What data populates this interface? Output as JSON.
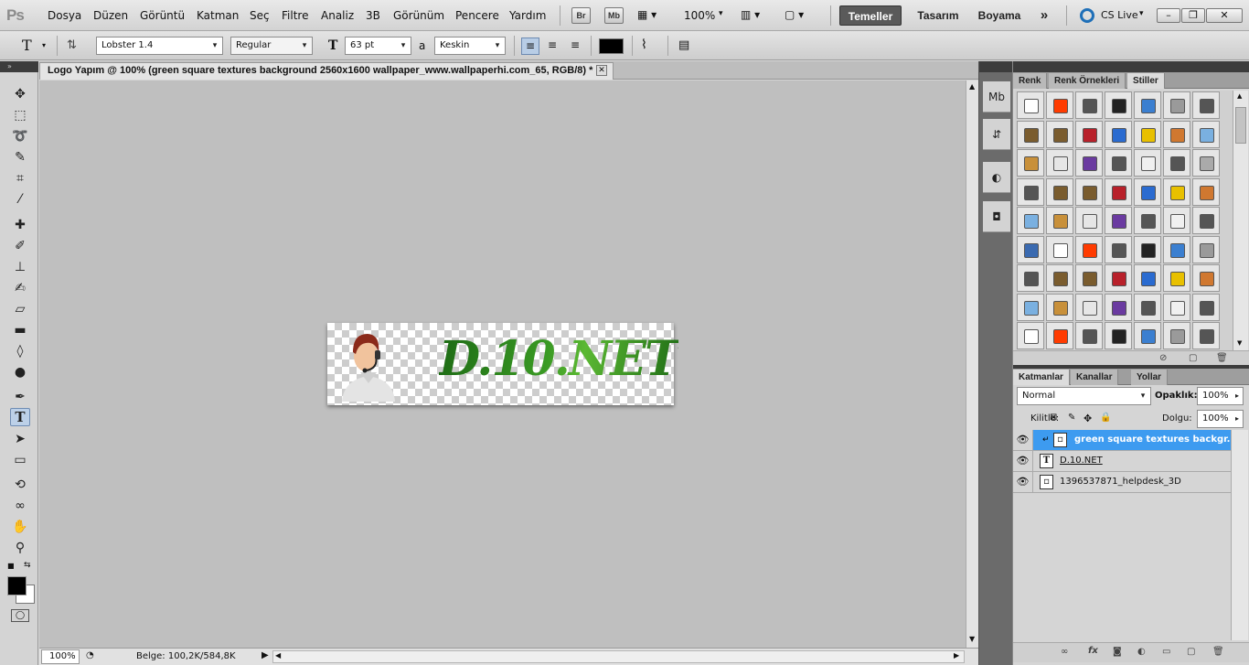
{
  "app": {
    "logo": "Ps"
  },
  "menu": [
    "Dosya",
    "Düzen",
    "Görüntü",
    "Katman",
    "Seç",
    "Filtre",
    "Analiz",
    "3B",
    "Görünüm",
    "Pencere",
    "Yardım"
  ],
  "appbar": {
    "br": "Br",
    "mb": "Mb",
    "zoom": "100%"
  },
  "workspaces": [
    "Temeller",
    "Tasarım",
    "Boyama"
  ],
  "more_workspaces": "»",
  "cs_live": "CS Live",
  "window_buttons": [
    "–",
    "❐",
    "✕"
  ],
  "options": {
    "tool_glyph": "T",
    "font_family": "Lobster 1.4",
    "font_style": "Regular",
    "font_size": "63 pt",
    "aa_label": "a",
    "antialias": "Keskin"
  },
  "document": {
    "tab_title": "Logo Yapım @ 100% (green square textures background 2560x1600 wallpaper_www.wallpaperhi.com_65, RGB/8) *",
    "artwork_text": "D.10.NET",
    "zoom": "100%",
    "doc_size": "Belge: 100,2K/584,8K"
  },
  "panels": {
    "color_tabs": [
      "Renk",
      "Renk Örnekleri",
      "Stiller"
    ],
    "layer_tabs": [
      "Katmanlar",
      "Kanallar",
      "Yollar"
    ],
    "blend_mode": "Normal",
    "opacity_label": "Opaklık:",
    "opacity": "100%",
    "lock_label": "Kilitle:",
    "fill_label": "Dolgu:",
    "fill": "100%",
    "layers": [
      {
        "name": "green square textures backgr...",
        "selected": true,
        "type": "smart"
      },
      {
        "name": "D.10.NET",
        "selected": false,
        "type": "text"
      },
      {
        "name": "1396537871_helpdesk_3D",
        "selected": false,
        "type": "smart"
      }
    ]
  },
  "style_swatches": [
    [
      "#ffffff",
      "#ff3b00",
      "#555",
      "#222",
      "#3b7fd0",
      "#9a9a9a",
      "#555"
    ],
    [
      "#7a5c2e",
      "#7a5c2e",
      "#b8202a",
      "#2a6bd0",
      "#e8c000",
      "#d07830",
      "#7ab0e0"
    ],
    [
      "#c8903a",
      "#e6e6e6",
      "#6a3aa0",
      "#555",
      "#f0f0f0",
      "#555",
      "#aaa"
    ],
    [
      "#555",
      "#7a5c2e",
      "#7a5c2e",
      "#b8202a",
      "#2a6bd0",
      "#e8c000",
      "#d07830"
    ],
    [
      "#7ab0e0",
      "#c8903a",
      "#e6e6e6",
      "#6a3aa0",
      "#555",
      "#f0f0f0",
      "#555"
    ],
    [
      "#3a6ab0",
      "#ffffff",
      "#ff3b00",
      "#555",
      "#222",
      "#3b7fd0",
      "#9a9a9a"
    ],
    [
      "#555",
      "#7a5c2e",
      "#7a5c2e",
      "#b8202a",
      "#2a6bd0",
      "#e8c000",
      "#d07830"
    ],
    [
      "#7ab0e0",
      "#c8903a",
      "#e6e6e6",
      "#6a3aa0",
      "#555",
      "#f0f0f0",
      "#555"
    ],
    [
      "#ffffff",
      "#ff3b00",
      "#555",
      "#222",
      "#3b7fd0",
      "#9a9a9a",
      "#555"
    ]
  ],
  "colors": {
    "selection": "#3d9bf0",
    "accent_tab": "#5a5a5a"
  }
}
